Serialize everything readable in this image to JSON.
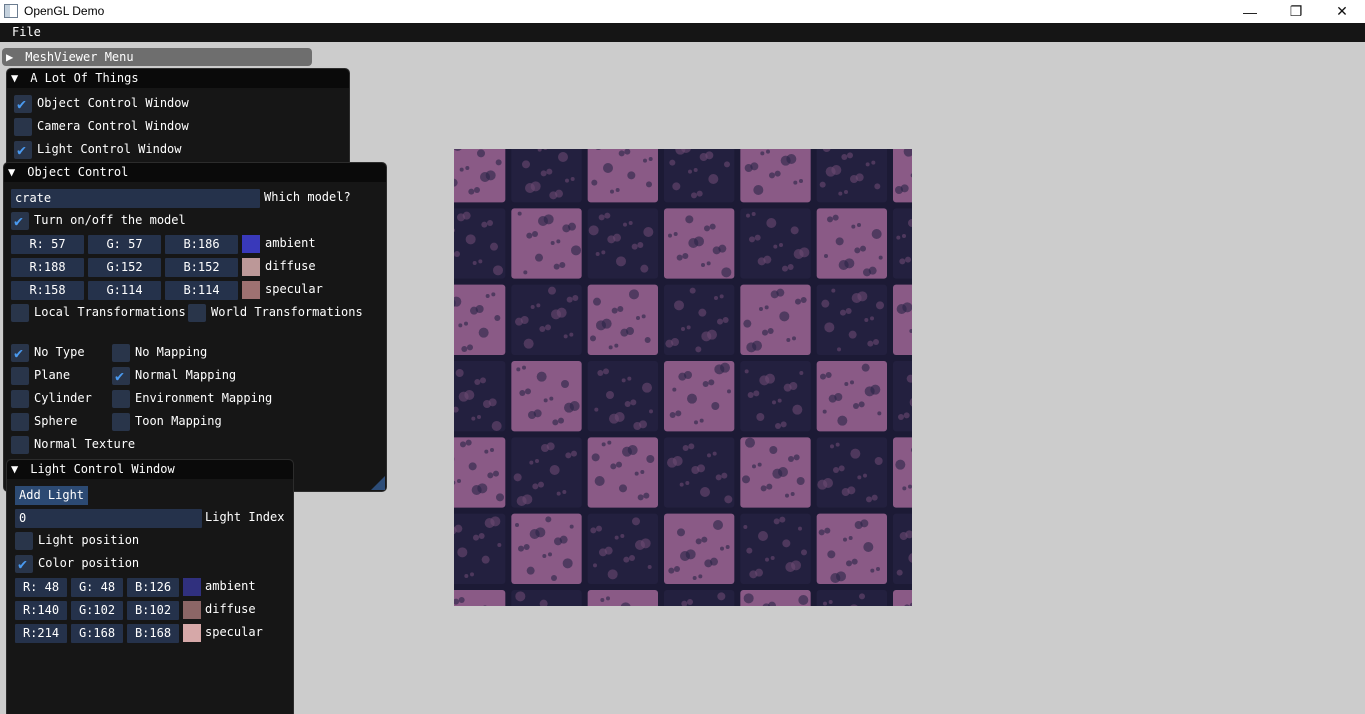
{
  "window": {
    "title": "OpenGL Demo",
    "minimize_glyph": "—",
    "maximize_glyph": "❐",
    "close_glyph": "✕"
  },
  "menubar": {
    "file": "File"
  },
  "meshviewer_menu": {
    "label": "MeshViewer Menu"
  },
  "a_lot_of_things": {
    "title": "A Lot Of Things",
    "items": [
      {
        "label": "Object Control Window",
        "checked": true
      },
      {
        "label": "Camera Control Window",
        "checked": false
      },
      {
        "label": "Light Control Window",
        "checked": true
      }
    ]
  },
  "object_control": {
    "title": "Object Control",
    "model_input": "crate",
    "model_label": "Which model?",
    "turn_onoff": {
      "label": "Turn on/off the model",
      "checked": true
    },
    "colors": [
      {
        "r": "R: 57",
        "g": "G: 57",
        "b": "B:186",
        "swatch": "#3939ba",
        "label": "ambient"
      },
      {
        "r": "R:188",
        "g": "G:152",
        "b": "B:152",
        "swatch": "#bc9898",
        "label": "diffuse"
      },
      {
        "r": "R:158",
        "g": "G:114",
        "b": "B:114",
        "swatch": "#9e7272",
        "label": "specular"
      }
    ],
    "local_transform": {
      "label": "Local Transformations",
      "checked": false
    },
    "world_transform": {
      "label": "World Transformations",
      "checked": false
    },
    "types": [
      {
        "label": "No Type",
        "checked": true
      },
      {
        "label": "Plane",
        "checked": false
      },
      {
        "label": "Cylinder",
        "checked": false
      },
      {
        "label": "Sphere",
        "checked": false
      },
      {
        "label": "Normal Texture",
        "checked": false
      }
    ],
    "mappings": [
      {
        "label": "No Mapping",
        "checked": false
      },
      {
        "label": "Normal Mapping",
        "checked": true
      },
      {
        "label": "Environment Mapping",
        "checked": false
      },
      {
        "label": "Toon Mapping",
        "checked": false
      }
    ]
  },
  "light_control": {
    "title": "Light Control Window",
    "add_light": "Add Light",
    "light_index_value": "0",
    "light_index_label": "Light Index",
    "light_position": {
      "label": "Light position",
      "checked": false
    },
    "color_position": {
      "label": "Color position",
      "checked": true
    },
    "colors": [
      {
        "r": "R: 48",
        "g": "G: 48",
        "b": "B:126",
        "swatch": "#30307e",
        "label": "ambient"
      },
      {
        "r": "R:140",
        "g": "G:102",
        "b": "B:102",
        "swatch": "#8c6666",
        "label": "diffuse"
      },
      {
        "r": "R:214",
        "g": "G:168",
        "b": "B:168",
        "swatch": "#d6a8a8",
        "label": "specular"
      }
    ]
  },
  "icons": {
    "collapsed": "▶",
    "expanded": "▼",
    "check": "✔"
  },
  "colors": {
    "check": "#4a9af0",
    "field": "#25324b",
    "checkbox": "#29354a",
    "window": "#161616"
  }
}
